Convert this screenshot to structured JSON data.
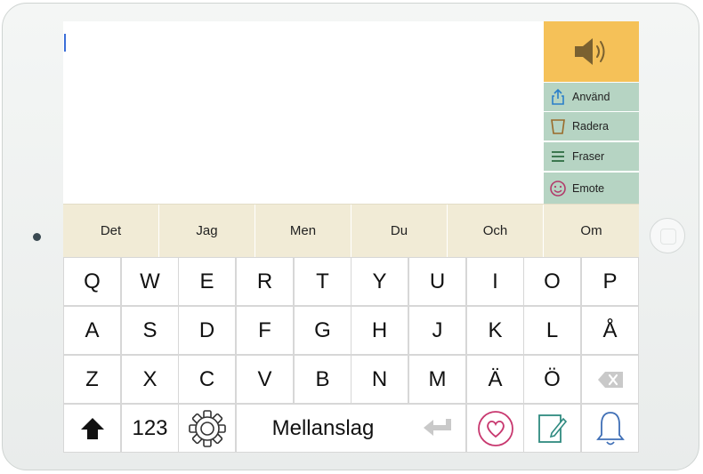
{
  "action_panel": {
    "speak_icon": "speaker-icon",
    "buttons": [
      {
        "label": "Använd",
        "icon": "share-icon"
      },
      {
        "label": "Radera",
        "icon": "trash-icon"
      },
      {
        "label": "Fraser",
        "icon": "list-icon"
      },
      {
        "label": "Emote",
        "icon": "smiley-icon"
      }
    ]
  },
  "suggestions": [
    "Det",
    "Jag",
    "Men",
    "Du",
    "Och",
    "Om"
  ],
  "keyboard": {
    "rows": [
      [
        "Q",
        "W",
        "E",
        "R",
        "T",
        "Y",
        "U",
        "I",
        "O",
        "P"
      ],
      [
        "A",
        "S",
        "D",
        "F",
        "G",
        "H",
        "J",
        "K",
        "L",
        "Å"
      ],
      [
        "Z",
        "X",
        "C",
        "V",
        "B",
        "N",
        "M",
        "Ä",
        "Ö"
      ]
    ],
    "numbers_label": "123",
    "space_label": "Mellanslag",
    "icons": {
      "backspace": "backspace-icon",
      "shift": "shift-arrow-icon",
      "settings": "gear-icon",
      "enter": "return-arrow-icon",
      "favorites": "heart-icon",
      "notes": "note-edit-icon",
      "bell": "bell-icon"
    }
  },
  "colors": {
    "speak_bg": "#f5c158",
    "panel_bg": "#b6d4c3",
    "suggest_bg": "#f1ebd6",
    "heart": "#c8386f",
    "note": "#2f8a80",
    "bell": "#3f6fb6"
  }
}
